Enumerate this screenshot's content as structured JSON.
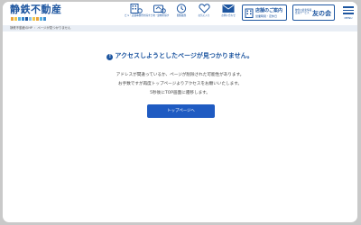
{
  "logo": {
    "text": "静鉄不動産",
    "bar_colors": [
      "#e8a33d",
      "#f0c74a",
      "#5cb3e0",
      "#3a8ad0",
      "#1e56a0",
      "#8fc3e8",
      "#f0c74a",
      "#e8a33d",
      "#5cb3e0",
      "#3a8ad0"
    ]
  },
  "nav": [
    {
      "id": "building-search",
      "icon": "building-icon",
      "label": "ビル・店舗事務所を探す"
    },
    {
      "id": "land-search",
      "icon": "house-card-icon",
      "label": "土地・建物を探す"
    },
    {
      "id": "history",
      "icon": "clock-icon",
      "label": "閲覧履歴"
    },
    {
      "id": "favorites",
      "icon": "heart-icon",
      "label": "お気に入り"
    },
    {
      "id": "contact",
      "icon": "mail-icon",
      "label": "お問い合わせ"
    }
  ],
  "shop": {
    "title": "店舗のご案内",
    "subtitle": "営業時間・定休日"
  },
  "member": {
    "sub_line1": "物件の最新情報",
    "sub_line2": "会員サービス",
    "main": "友の会"
  },
  "menu": {
    "label": "MENU"
  },
  "breadcrumb": {
    "home": "静鉄不動産のHP",
    "current": "ページが見つかりません"
  },
  "error": {
    "title": "アクセスしようとしたページが見つかりません。",
    "line1": "アドレスが間違っているか、ページが削除された可能性があります。",
    "line2": "お手数ですが再度トップページよりアクセスをお願いいたします。",
    "line3": "5秒後にTOP画面に遷移します。"
  },
  "top_button": {
    "label": "トップページへ"
  },
  "colors": {
    "brand": "#1e56a0",
    "button": "#1f5bc2",
    "breadcrumb_bg": "#e9eef5"
  }
}
